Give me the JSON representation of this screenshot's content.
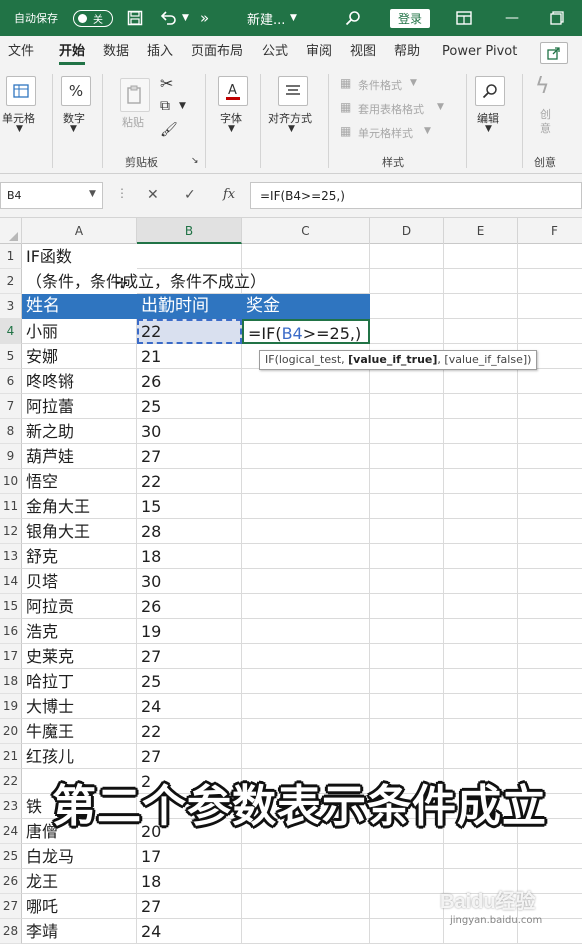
{
  "titlebar": {
    "autosave_label": "自动保存",
    "autosave_state": "关",
    "doc_title": "新建...",
    "login_label": "登录",
    "accent": "#217346",
    "icons": [
      "save-icon",
      "undo-icon",
      "more-icon",
      "search-icon",
      "ribbon-display-icon",
      "minimize-icon",
      "restore-icon"
    ]
  },
  "tabs": [
    "文件",
    "开始",
    "数据",
    "插入",
    "页面布局",
    "公式",
    "审阅",
    "视图",
    "帮助",
    "Power Pivot"
  ],
  "active_tab": "开始",
  "ribbon": {
    "cell_btn": "单元格",
    "number_btn": "数字",
    "paste_btn": "粘贴",
    "clipboard_group": "剪贴板",
    "font_btn": "字体",
    "align_btn": "对齐方式",
    "cond_format": "条件格式",
    "table_format": "套用表格格式",
    "cell_style": "单元格样式",
    "styles_group": "样式",
    "edit_btn": "编辑",
    "create_btn": "创\n意",
    "create_group": "创意"
  },
  "formula_bar": {
    "name_box": "B4",
    "formula": "=IF(B4>=25,)"
  },
  "columns": [
    "A",
    "B",
    "C",
    "D",
    "E",
    "F"
  ],
  "sheet": {
    "a1": "IF函数",
    "a2": "（条件，条件成立，条件不成立）",
    "headers": [
      "姓名",
      "出勤时间",
      "奖金"
    ],
    "header_color": "#2f75c0",
    "rows": [
      {
        "num": "4",
        "name": "小丽",
        "value": "22"
      },
      {
        "num": "5",
        "name": "安娜",
        "value": "21"
      },
      {
        "num": "6",
        "name": "咚咚锵",
        "value": "26"
      },
      {
        "num": "7",
        "name": "阿拉蕾",
        "value": "25"
      },
      {
        "num": "8",
        "name": "新之助",
        "value": "30"
      },
      {
        "num": "9",
        "name": "葫芦娃",
        "value": "27"
      },
      {
        "num": "10",
        "name": "悟空",
        "value": "22"
      },
      {
        "num": "11",
        "name": "金角大王",
        "value": "15"
      },
      {
        "num": "12",
        "name": "银角大王",
        "value": "28"
      },
      {
        "num": "13",
        "name": "舒克",
        "value": "18"
      },
      {
        "num": "14",
        "name": "贝塔",
        "value": "30"
      },
      {
        "num": "15",
        "name": "阿拉贡",
        "value": "26"
      },
      {
        "num": "16",
        "name": "浩克",
        "value": "19"
      },
      {
        "num": "17",
        "name": "史莱克",
        "value": "27"
      },
      {
        "num": "18",
        "name": "哈拉丁",
        "value": "25"
      },
      {
        "num": "19",
        "name": "大博士",
        "value": "24"
      },
      {
        "num": "20",
        "name": "牛魔王",
        "value": "22"
      },
      {
        "num": "21",
        "name": "红孩儿",
        "value": "27"
      },
      {
        "num": "22",
        "name": "",
        "value": "2"
      },
      {
        "num": "23",
        "name": "铁",
        "value": ""
      },
      {
        "num": "24",
        "name": "唐僧",
        "value": "20"
      },
      {
        "num": "25",
        "name": "白龙马",
        "value": "17"
      },
      {
        "num": "26",
        "name": "龙王",
        "value": "18"
      },
      {
        "num": "27",
        "name": "哪吒",
        "value": "27"
      },
      {
        "num": "28",
        "name": "李靖",
        "value": "24"
      }
    ],
    "c4_formula_prefix": "=IF(",
    "c4_formula_ref": "B4",
    "c4_formula_suffix": ">=25,)"
  },
  "tooltip": {
    "prefix": "IF(logical_test, ",
    "bold": "[value_if_true]",
    "suffix": ", [value_if_false])"
  },
  "subtitle": "第二个参数表示条件成立",
  "watermark": {
    "logo": "Baidu经验",
    "url": "jingyan.baidu.com"
  }
}
